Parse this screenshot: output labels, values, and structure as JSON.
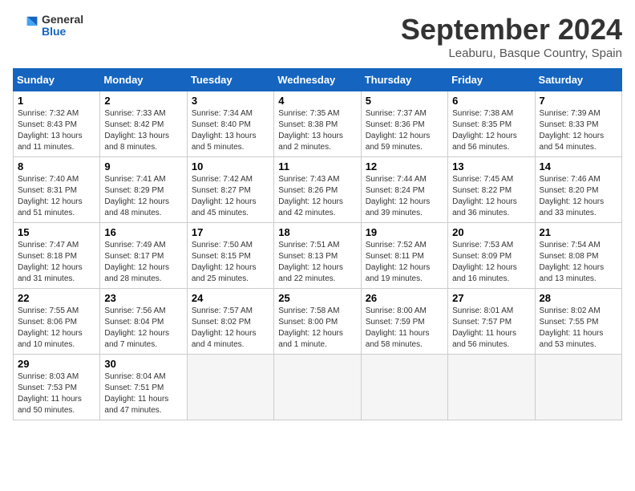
{
  "header": {
    "logo_general": "General",
    "logo_blue": "Blue",
    "month_title": "September 2024",
    "location": "Leaburu, Basque Country, Spain"
  },
  "columns": [
    "Sunday",
    "Monday",
    "Tuesday",
    "Wednesday",
    "Thursday",
    "Friday",
    "Saturday"
  ],
  "weeks": [
    [
      {
        "day": "1",
        "lines": [
          "Sunrise: 7:32 AM",
          "Sunset: 8:43 PM",
          "Daylight: 13 hours",
          "and 11 minutes."
        ]
      },
      {
        "day": "2",
        "lines": [
          "Sunrise: 7:33 AM",
          "Sunset: 8:42 PM",
          "Daylight: 13 hours",
          "and 8 minutes."
        ]
      },
      {
        "day": "3",
        "lines": [
          "Sunrise: 7:34 AM",
          "Sunset: 8:40 PM",
          "Daylight: 13 hours",
          "and 5 minutes."
        ]
      },
      {
        "day": "4",
        "lines": [
          "Sunrise: 7:35 AM",
          "Sunset: 8:38 PM",
          "Daylight: 13 hours",
          "and 2 minutes."
        ]
      },
      {
        "day": "5",
        "lines": [
          "Sunrise: 7:37 AM",
          "Sunset: 8:36 PM",
          "Daylight: 12 hours",
          "and 59 minutes."
        ]
      },
      {
        "day": "6",
        "lines": [
          "Sunrise: 7:38 AM",
          "Sunset: 8:35 PM",
          "Daylight: 12 hours",
          "and 56 minutes."
        ]
      },
      {
        "day": "7",
        "lines": [
          "Sunrise: 7:39 AM",
          "Sunset: 8:33 PM",
          "Daylight: 12 hours",
          "and 54 minutes."
        ]
      }
    ],
    [
      {
        "day": "8",
        "lines": [
          "Sunrise: 7:40 AM",
          "Sunset: 8:31 PM",
          "Daylight: 12 hours",
          "and 51 minutes."
        ]
      },
      {
        "day": "9",
        "lines": [
          "Sunrise: 7:41 AM",
          "Sunset: 8:29 PM",
          "Daylight: 12 hours",
          "and 48 minutes."
        ]
      },
      {
        "day": "10",
        "lines": [
          "Sunrise: 7:42 AM",
          "Sunset: 8:27 PM",
          "Daylight: 12 hours",
          "and 45 minutes."
        ]
      },
      {
        "day": "11",
        "lines": [
          "Sunrise: 7:43 AM",
          "Sunset: 8:26 PM",
          "Daylight: 12 hours",
          "and 42 minutes."
        ]
      },
      {
        "day": "12",
        "lines": [
          "Sunrise: 7:44 AM",
          "Sunset: 8:24 PM",
          "Daylight: 12 hours",
          "and 39 minutes."
        ]
      },
      {
        "day": "13",
        "lines": [
          "Sunrise: 7:45 AM",
          "Sunset: 8:22 PM",
          "Daylight: 12 hours",
          "and 36 minutes."
        ]
      },
      {
        "day": "14",
        "lines": [
          "Sunrise: 7:46 AM",
          "Sunset: 8:20 PM",
          "Daylight: 12 hours",
          "and 33 minutes."
        ]
      }
    ],
    [
      {
        "day": "15",
        "lines": [
          "Sunrise: 7:47 AM",
          "Sunset: 8:18 PM",
          "Daylight: 12 hours",
          "and 31 minutes."
        ]
      },
      {
        "day": "16",
        "lines": [
          "Sunrise: 7:49 AM",
          "Sunset: 8:17 PM",
          "Daylight: 12 hours",
          "and 28 minutes."
        ]
      },
      {
        "day": "17",
        "lines": [
          "Sunrise: 7:50 AM",
          "Sunset: 8:15 PM",
          "Daylight: 12 hours",
          "and 25 minutes."
        ]
      },
      {
        "day": "18",
        "lines": [
          "Sunrise: 7:51 AM",
          "Sunset: 8:13 PM",
          "Daylight: 12 hours",
          "and 22 minutes."
        ]
      },
      {
        "day": "19",
        "lines": [
          "Sunrise: 7:52 AM",
          "Sunset: 8:11 PM",
          "Daylight: 12 hours",
          "and 19 minutes."
        ]
      },
      {
        "day": "20",
        "lines": [
          "Sunrise: 7:53 AM",
          "Sunset: 8:09 PM",
          "Daylight: 12 hours",
          "and 16 minutes."
        ]
      },
      {
        "day": "21",
        "lines": [
          "Sunrise: 7:54 AM",
          "Sunset: 8:08 PM",
          "Daylight: 12 hours",
          "and 13 minutes."
        ]
      }
    ],
    [
      {
        "day": "22",
        "lines": [
          "Sunrise: 7:55 AM",
          "Sunset: 8:06 PM",
          "Daylight: 12 hours",
          "and 10 minutes."
        ]
      },
      {
        "day": "23",
        "lines": [
          "Sunrise: 7:56 AM",
          "Sunset: 8:04 PM",
          "Daylight: 12 hours",
          "and 7 minutes."
        ]
      },
      {
        "day": "24",
        "lines": [
          "Sunrise: 7:57 AM",
          "Sunset: 8:02 PM",
          "Daylight: 12 hours",
          "and 4 minutes."
        ]
      },
      {
        "day": "25",
        "lines": [
          "Sunrise: 7:58 AM",
          "Sunset: 8:00 PM",
          "Daylight: 12 hours",
          "and 1 minute."
        ]
      },
      {
        "day": "26",
        "lines": [
          "Sunrise: 8:00 AM",
          "Sunset: 7:59 PM",
          "Daylight: 11 hours",
          "and 58 minutes."
        ]
      },
      {
        "day": "27",
        "lines": [
          "Sunrise: 8:01 AM",
          "Sunset: 7:57 PM",
          "Daylight: 11 hours",
          "and 56 minutes."
        ]
      },
      {
        "day": "28",
        "lines": [
          "Sunrise: 8:02 AM",
          "Sunset: 7:55 PM",
          "Daylight: 11 hours",
          "and 53 minutes."
        ]
      }
    ],
    [
      {
        "day": "29",
        "lines": [
          "Sunrise: 8:03 AM",
          "Sunset: 7:53 PM",
          "Daylight: 11 hours",
          "and 50 minutes."
        ]
      },
      {
        "day": "30",
        "lines": [
          "Sunrise: 8:04 AM",
          "Sunset: 7:51 PM",
          "Daylight: 11 hours",
          "and 47 minutes."
        ]
      },
      {
        "day": "",
        "lines": []
      },
      {
        "day": "",
        "lines": []
      },
      {
        "day": "",
        "lines": []
      },
      {
        "day": "",
        "lines": []
      },
      {
        "day": "",
        "lines": []
      }
    ]
  ]
}
